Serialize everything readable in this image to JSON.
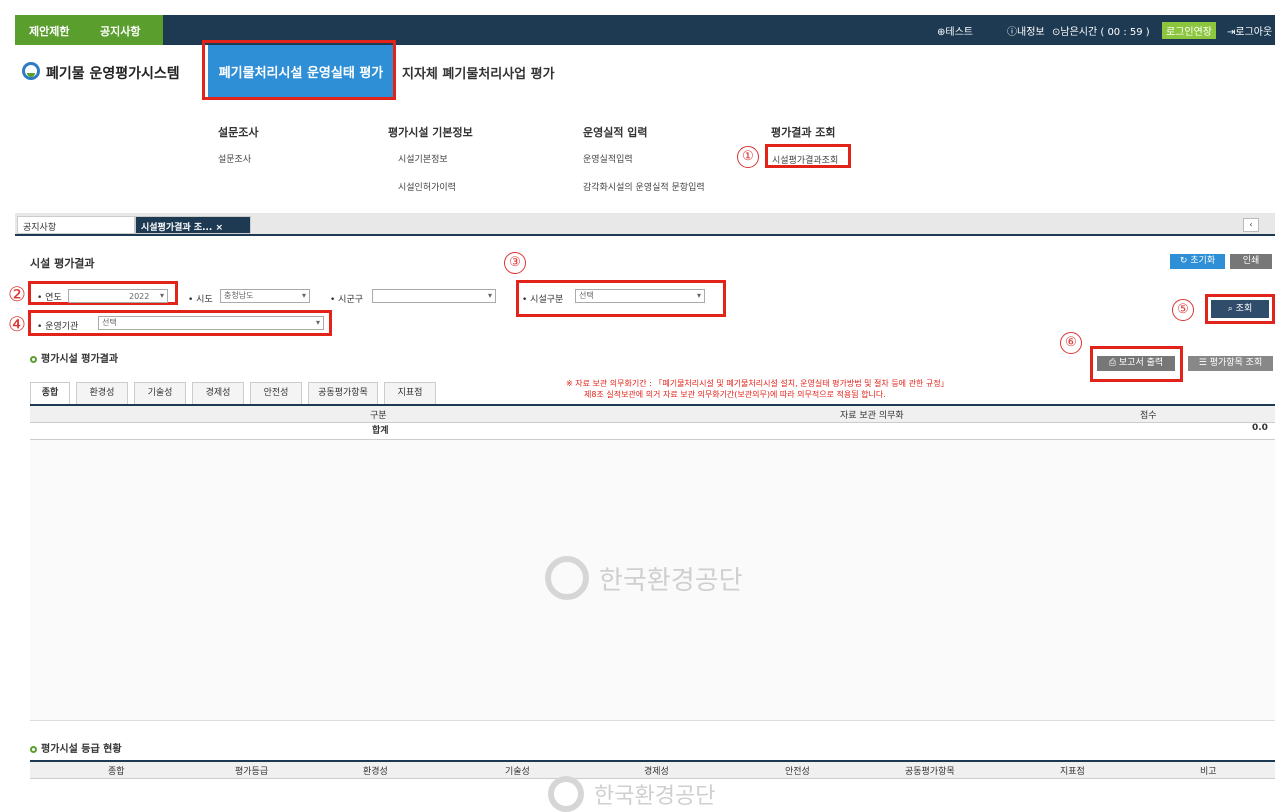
{
  "topbar": {
    "links": [
      "제안제한",
      "공지사항"
    ],
    "user": "테스트",
    "my_info": "내정보",
    "remaining_time": "남은시간 ( 00 : 59 )",
    "extend_login": "로그인연장",
    "logout": "로그아웃"
  },
  "logo_text": "폐기물 운영평가시스템",
  "nav": {
    "active_tab": "폐기물처리시설 운영실태 평가",
    "tab2": "지자체 폐기물처리사업 평가"
  },
  "menu": {
    "columns": [
      {
        "header": "설문조사",
        "items": [
          "설문조사"
        ]
      },
      {
        "header": "평가시설 기본정보",
        "items": [
          "시설기본정보",
          "시설인허가이력"
        ]
      },
      {
        "header": "운영실적 입력",
        "items": [
          "운영실적입력",
          "감각화시설의 운영실적 문항입력"
        ]
      },
      {
        "header": "평가결과 조회",
        "items": [
          "시설평가결과조회"
        ]
      }
    ]
  },
  "markers": [
    "①",
    "②",
    "③",
    "④",
    "⑤",
    "⑥"
  ],
  "window_tabs": [
    {
      "label": "공지사항"
    },
    {
      "label": "시설평가결과 조... ×"
    }
  ],
  "page_title": "시설 평가결과",
  "top_buttons": {
    "init": "초기화",
    "print": "인쇄"
  },
  "filters": {
    "year_label": "• 연도",
    "year_value": "2022",
    "sido_label": "• 시도",
    "sido_value": "충청남도",
    "sigungu_label": "• 시군구",
    "sigungu_value": "",
    "facility_type_label": "• 시설구분",
    "facility_type_value": "선택",
    "org_label": "• 운영기관",
    "org_value": "선택",
    "search_button": "조회"
  },
  "result_section": {
    "title": "평가시설 평가결과",
    "report_button": "보고서 출력",
    "facility_list_button": "평가항목 조회",
    "notice_line1": "※ 자료 보관 의무화기간 : 「폐기물처리시설 및 폐기물처리시설 설치, 운영실태 평가방법 및 절차 등에 관한 규정」",
    "notice_line2": "제8조 실적보관에 의거 자료 보관 의무화기간(보관의무)에 따라 의무적으로 적용됨 합니다.",
    "subtabs": [
      "종합",
      "환경성",
      "기술성",
      "경제성",
      "안전성",
      "공동평가항목",
      "지표점"
    ],
    "columns": [
      "구분",
      "자료 보관 의무화",
      "점수"
    ],
    "total_row": {
      "label": "합계",
      "score": "0.0"
    }
  },
  "watermark": "한국환경공단",
  "grade_section": {
    "title": "평가시설 등급 현황",
    "columns": [
      "종합",
      "평가등급",
      "환경성",
      "기술성",
      "경제성",
      "안전성",
      "공동평가항목",
      "지표점",
      "비고"
    ]
  }
}
